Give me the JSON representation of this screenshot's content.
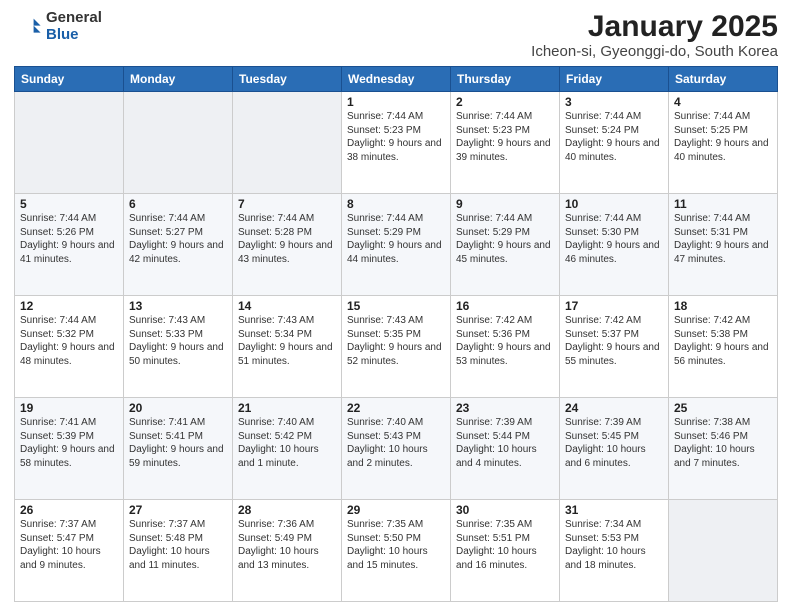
{
  "logo": {
    "general": "General",
    "blue": "Blue"
  },
  "title": "January 2025",
  "subtitle": "Icheon-si, Gyeonggi-do, South Korea",
  "days_of_week": [
    "Sunday",
    "Monday",
    "Tuesday",
    "Wednesday",
    "Thursday",
    "Friday",
    "Saturday"
  ],
  "weeks": [
    [
      {
        "day": "",
        "info": ""
      },
      {
        "day": "",
        "info": ""
      },
      {
        "day": "",
        "info": ""
      },
      {
        "day": "1",
        "info": "Sunrise: 7:44 AM\nSunset: 5:23 PM\nDaylight: 9 hours and 38 minutes."
      },
      {
        "day": "2",
        "info": "Sunrise: 7:44 AM\nSunset: 5:23 PM\nDaylight: 9 hours and 39 minutes."
      },
      {
        "day": "3",
        "info": "Sunrise: 7:44 AM\nSunset: 5:24 PM\nDaylight: 9 hours and 40 minutes."
      },
      {
        "day": "4",
        "info": "Sunrise: 7:44 AM\nSunset: 5:25 PM\nDaylight: 9 hours and 40 minutes."
      }
    ],
    [
      {
        "day": "5",
        "info": "Sunrise: 7:44 AM\nSunset: 5:26 PM\nDaylight: 9 hours and 41 minutes."
      },
      {
        "day": "6",
        "info": "Sunrise: 7:44 AM\nSunset: 5:27 PM\nDaylight: 9 hours and 42 minutes."
      },
      {
        "day": "7",
        "info": "Sunrise: 7:44 AM\nSunset: 5:28 PM\nDaylight: 9 hours and 43 minutes."
      },
      {
        "day": "8",
        "info": "Sunrise: 7:44 AM\nSunset: 5:29 PM\nDaylight: 9 hours and 44 minutes."
      },
      {
        "day": "9",
        "info": "Sunrise: 7:44 AM\nSunset: 5:29 PM\nDaylight: 9 hours and 45 minutes."
      },
      {
        "day": "10",
        "info": "Sunrise: 7:44 AM\nSunset: 5:30 PM\nDaylight: 9 hours and 46 minutes."
      },
      {
        "day": "11",
        "info": "Sunrise: 7:44 AM\nSunset: 5:31 PM\nDaylight: 9 hours and 47 minutes."
      }
    ],
    [
      {
        "day": "12",
        "info": "Sunrise: 7:44 AM\nSunset: 5:32 PM\nDaylight: 9 hours and 48 minutes."
      },
      {
        "day": "13",
        "info": "Sunrise: 7:43 AM\nSunset: 5:33 PM\nDaylight: 9 hours and 50 minutes."
      },
      {
        "day": "14",
        "info": "Sunrise: 7:43 AM\nSunset: 5:34 PM\nDaylight: 9 hours and 51 minutes."
      },
      {
        "day": "15",
        "info": "Sunrise: 7:43 AM\nSunset: 5:35 PM\nDaylight: 9 hours and 52 minutes."
      },
      {
        "day": "16",
        "info": "Sunrise: 7:42 AM\nSunset: 5:36 PM\nDaylight: 9 hours and 53 minutes."
      },
      {
        "day": "17",
        "info": "Sunrise: 7:42 AM\nSunset: 5:37 PM\nDaylight: 9 hours and 55 minutes."
      },
      {
        "day": "18",
        "info": "Sunrise: 7:42 AM\nSunset: 5:38 PM\nDaylight: 9 hours and 56 minutes."
      }
    ],
    [
      {
        "day": "19",
        "info": "Sunrise: 7:41 AM\nSunset: 5:39 PM\nDaylight: 9 hours and 58 minutes."
      },
      {
        "day": "20",
        "info": "Sunrise: 7:41 AM\nSunset: 5:41 PM\nDaylight: 9 hours and 59 minutes."
      },
      {
        "day": "21",
        "info": "Sunrise: 7:40 AM\nSunset: 5:42 PM\nDaylight: 10 hours and 1 minute."
      },
      {
        "day": "22",
        "info": "Sunrise: 7:40 AM\nSunset: 5:43 PM\nDaylight: 10 hours and 2 minutes."
      },
      {
        "day": "23",
        "info": "Sunrise: 7:39 AM\nSunset: 5:44 PM\nDaylight: 10 hours and 4 minutes."
      },
      {
        "day": "24",
        "info": "Sunrise: 7:39 AM\nSunset: 5:45 PM\nDaylight: 10 hours and 6 minutes."
      },
      {
        "day": "25",
        "info": "Sunrise: 7:38 AM\nSunset: 5:46 PM\nDaylight: 10 hours and 7 minutes."
      }
    ],
    [
      {
        "day": "26",
        "info": "Sunrise: 7:37 AM\nSunset: 5:47 PM\nDaylight: 10 hours and 9 minutes."
      },
      {
        "day": "27",
        "info": "Sunrise: 7:37 AM\nSunset: 5:48 PM\nDaylight: 10 hours and 11 minutes."
      },
      {
        "day": "28",
        "info": "Sunrise: 7:36 AM\nSunset: 5:49 PM\nDaylight: 10 hours and 13 minutes."
      },
      {
        "day": "29",
        "info": "Sunrise: 7:35 AM\nSunset: 5:50 PM\nDaylight: 10 hours and 15 minutes."
      },
      {
        "day": "30",
        "info": "Sunrise: 7:35 AM\nSunset: 5:51 PM\nDaylight: 10 hours and 16 minutes."
      },
      {
        "day": "31",
        "info": "Sunrise: 7:34 AM\nSunset: 5:53 PM\nDaylight: 10 hours and 18 minutes."
      },
      {
        "day": "",
        "info": ""
      }
    ]
  ]
}
